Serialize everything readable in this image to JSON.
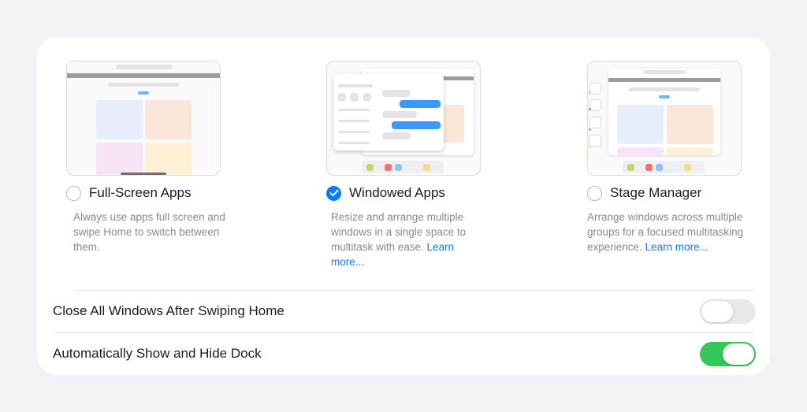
{
  "options": [
    {
      "label": "Full-Screen Apps",
      "selected": false,
      "desc": "Always use apps full screen and swipe Home to switch between them.",
      "link": ""
    },
    {
      "label": "Windowed Apps",
      "selected": true,
      "desc": "Resize and arrange multiple windows in a single space to multitask with ease. ",
      "link": "Learn more..."
    },
    {
      "label": "Stage Manager",
      "selected": false,
      "desc": "Arrange windows across multiple groups for a focused multitasking experience. ",
      "link": "Learn more..."
    }
  ],
  "settings": [
    {
      "label": "Close All Windows After Swiping Home",
      "enabled": false
    },
    {
      "label": "Automatically Show and Hide Dock",
      "enabled": true
    }
  ],
  "colors": {
    "accent": "#0A7AFF",
    "toggle_on": "#34C759",
    "toggle_off": "#E9E9EB"
  }
}
